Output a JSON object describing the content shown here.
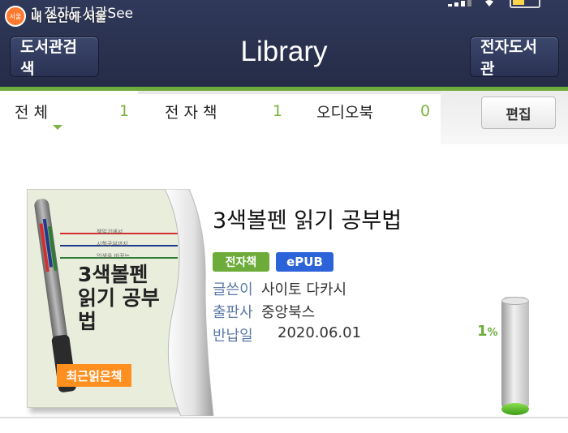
{
  "status_bar": {
    "carrier": "1 전자도서관See"
  },
  "watermark": {
    "logo_text": "서울",
    "text": "내 손안에 서울"
  },
  "header": {
    "title": "Library",
    "left_button": "도서관검색",
    "right_button": "전자도서관"
  },
  "filters": {
    "tabs": [
      {
        "label": "전   체",
        "count": "1"
      },
      {
        "label": "전 자 책",
        "count": "1"
      },
      {
        "label": "오디오북",
        "count": "0"
      }
    ],
    "edit_button": "편집"
  },
  "book": {
    "title": "3색볼펜 읽기 공부법",
    "tags": {
      "type": "전자책",
      "format": "ePUB"
    },
    "meta": [
      {
        "label": "글쓴이",
        "value": "사이토 다카시"
      },
      {
        "label": "출판사",
        "value": "중앙북스"
      },
      {
        "label": "반납일",
        "value": "2020.06.01"
      }
    ],
    "progress": 0.01,
    "progress_number": "1",
    "progress_unit": "%",
    "cover": {
      "subtitle_lines": [
        "책읽기에서",
        "시험공부까지",
        "인생을 바꾸는"
      ],
      "title_lines": [
        "3색볼펜",
        "읽기 공부법"
      ],
      "badge": "최근읽은책"
    }
  },
  "colors": {
    "header_bg": "#2b3350",
    "accent_green": "#6dac3a",
    "epub_blue": "#2d63d8",
    "label_blue": "#5b79a6",
    "badge_orange": "#ff8f1f"
  }
}
